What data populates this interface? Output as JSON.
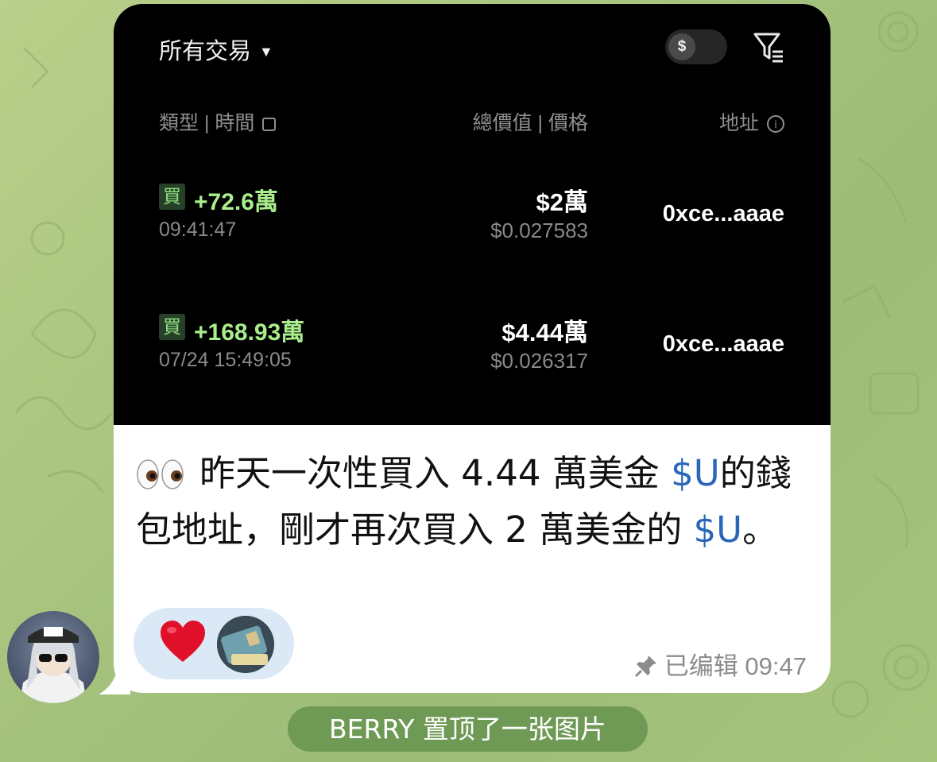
{
  "screenshot": {
    "filter_label": "所有交易",
    "toggle_symbol": "$",
    "headers": {
      "type_time": "類型 | 時間",
      "value_price": "總價值 | 價格",
      "address": "地址"
    },
    "transactions": [
      {
        "badge": "買",
        "amount": "+72.6萬",
        "time": "09:41:47",
        "total": "$2萬",
        "price": "$0.027583",
        "address": "0xce...aaae"
      },
      {
        "badge": "買",
        "amount": "+168.93萬",
        "time": "07/24 15:49:05",
        "total": "$4.44萬",
        "price": "$0.026317",
        "address": "0xce...aaae"
      }
    ]
  },
  "message": {
    "part1": "昨天一次性買入 4.44 萬美金 ",
    "tag1": "$U",
    "part2": "的錢包地址，剛才再次買入 2 萬美金的 ",
    "tag2": "$U",
    "part3": "。",
    "meta": "已编辑 09:47"
  },
  "service_message": "BERRY 置顶了一张图片",
  "colors": {
    "accent_green": "#a8ee8c",
    "tag_blue": "#2a67b8",
    "service_bg": "#6e9a55"
  }
}
